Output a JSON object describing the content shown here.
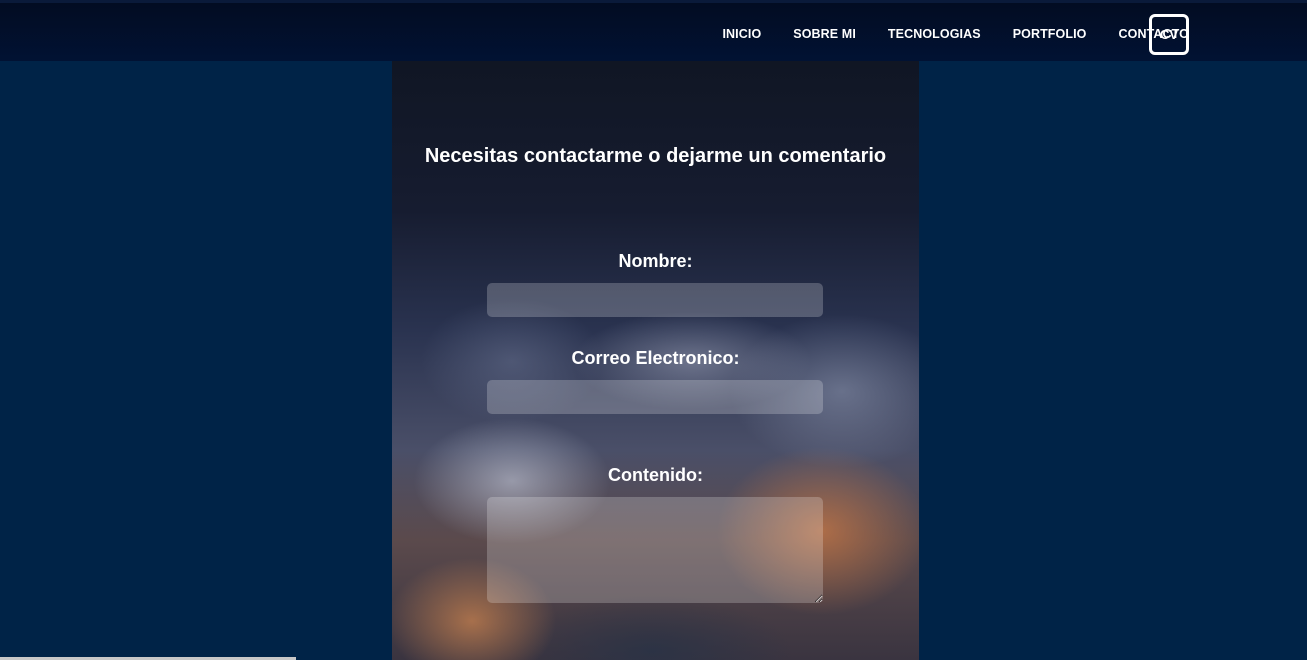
{
  "nav": {
    "links": [
      "INICIO",
      "SOBRE MI",
      "TECNOLOGIAS",
      "PORTFOLIO",
      "CONTACTO"
    ],
    "cv_label": "CV"
  },
  "contact": {
    "title": "Necesitas contactarme o dejarme un comentario",
    "name_label": "Nombre:",
    "name_value": "",
    "email_label": "Correo Electronico:",
    "email_value": "",
    "content_label": "Contenido:",
    "content_value": ""
  },
  "colors": {
    "page_background": "#002347",
    "navbar_background": "#011233",
    "text": "#ffffff"
  }
}
